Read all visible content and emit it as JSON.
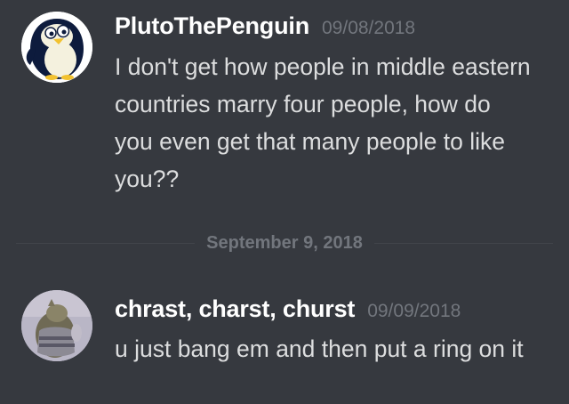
{
  "messages": [
    {
      "author": "PlutoThePenguin",
      "timestamp": "09/08/2018",
      "text": "I don't get how people in middle eastern countries marry four people, how do you even get that many people to like you??",
      "avatar_icon": "penguin-avatar-icon"
    },
    {
      "author": "chrast, charst, churst",
      "timestamp": "09/09/2018",
      "text": "u just bang em and then put a ring on it",
      "avatar_icon": "photo-avatar-icon"
    }
  ],
  "divider": {
    "label": "September 9, 2018"
  },
  "colors": {
    "background": "#36393f",
    "username": "#ffffff",
    "message_text": "#dcddde",
    "muted": "#72767d",
    "divider_line": "#42454a"
  }
}
